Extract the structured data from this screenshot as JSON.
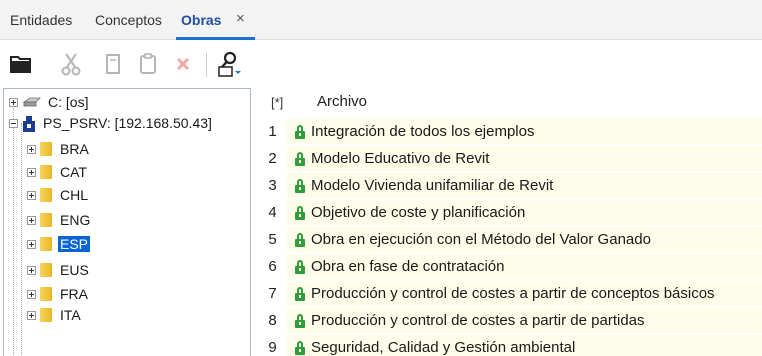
{
  "tabs": [
    {
      "label": "Entidades",
      "active": false
    },
    {
      "label": "Conceptos",
      "active": false
    },
    {
      "label": "Obras",
      "active": true
    }
  ],
  "tab_close": "×",
  "toolbar": {
    "icons": [
      "open-folder-icon",
      "cut-icon",
      "copy-icon",
      "paste-icon",
      "delete-icon",
      "search-icon"
    ]
  },
  "tree": {
    "drive": "C: [os]",
    "server": "PS_PSRV: [192.168.50.43]",
    "folders": [
      "BRA",
      "CAT",
      "CHL",
      "ENG",
      "ESP",
      "EUS",
      "FRA",
      "ITA"
    ],
    "selected": "ESP"
  },
  "list": {
    "star_header": "[*]",
    "column_header": "Archivo",
    "rows": [
      {
        "num": "1",
        "name": "Integración de todos los ejemplos"
      },
      {
        "num": "2",
        "name": "Modelo Educativo de Revit"
      },
      {
        "num": "3",
        "name": "Modelo Vivienda unifamiliar de Revit"
      },
      {
        "num": "4",
        "name": "Objetivo de coste y planificación"
      },
      {
        "num": "5",
        "name": "Obra en ejecución con el Método del Valor Ganado"
      },
      {
        "num": "6",
        "name": "Obra en fase de contratación"
      },
      {
        "num": "7",
        "name": "Producción y control de costes a partir de conceptos básicos"
      },
      {
        "num": "8",
        "name": "Producción y control de costes a partir de partidas"
      },
      {
        "num": "9",
        "name": "Seguridad, Calidad y Gestión ambiental"
      }
    ]
  },
  "colors": {
    "accent": "#1f6fd0",
    "selection": "#0b64d3",
    "lock": "#2e9d3a",
    "row_bg": "#fdfde9",
    "folder": "#f0c43a"
  }
}
